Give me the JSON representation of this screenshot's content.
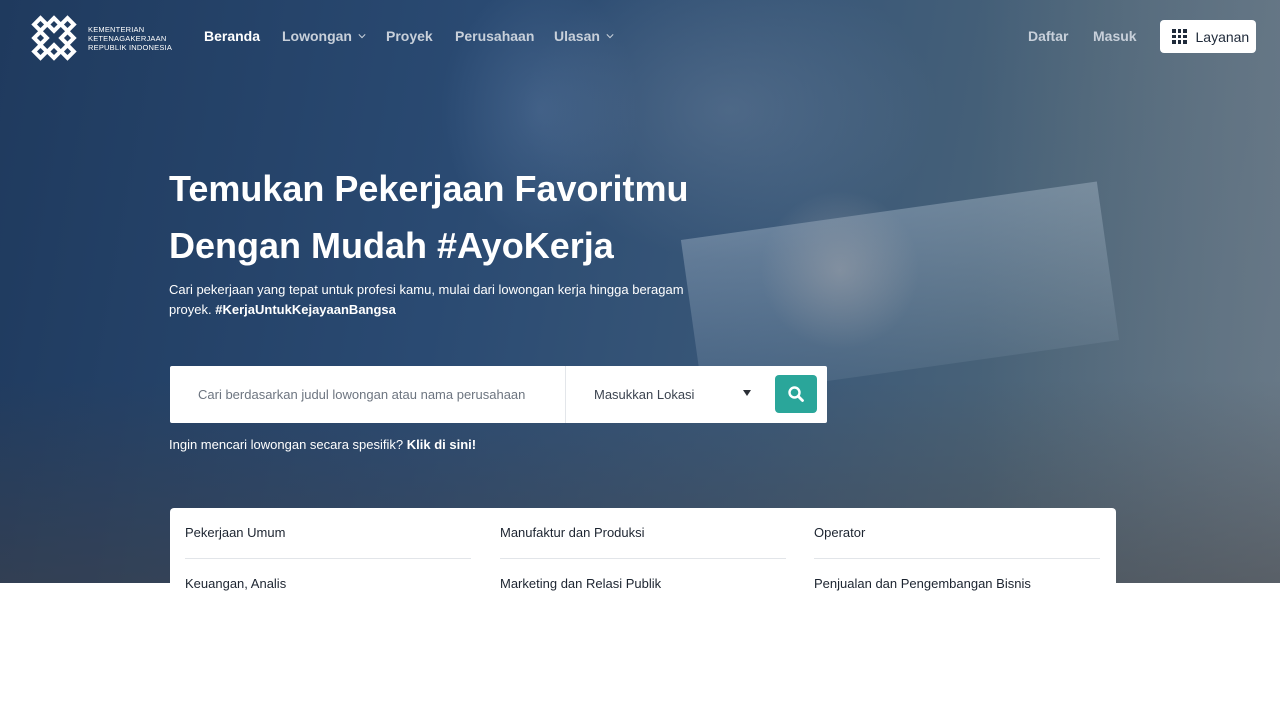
{
  "brand": {
    "line1": "KEMENTERIAN",
    "line2": "KETENAGAKERJAAN",
    "line3": "REPUBLIK INDONESIA"
  },
  "nav": {
    "items": [
      {
        "label": "Beranda"
      },
      {
        "label": "Lowongan"
      },
      {
        "label": "Proyek"
      },
      {
        "label": "Perusahaan"
      },
      {
        "label": "Ulasan"
      }
    ],
    "daftar": "Daftar",
    "masuk": "Masuk",
    "layanan": "Layanan"
  },
  "hero": {
    "title_line1": "Temukan Pekerjaan Favoritmu",
    "title_line2": "Dengan Mudah #AyoKerja",
    "subtitle": "Cari pekerjaan yang tepat untuk profesi kamu, mulai dari lowongan kerja hingga beragam proyek.",
    "hashtag": "#KerjaUntukKejayaanBangsa"
  },
  "search": {
    "placeholder": "Cari berdasarkan judul lowongan atau nama perusahaan",
    "location_placeholder": "Masukkan Lokasi",
    "specific_prefix": "Ingin mencari lowongan secara spesifik?",
    "specific_link": "Klik di sini!"
  },
  "categories": [
    "Pekerjaan Umum",
    "Manufaktur dan Produksi",
    "Operator",
    "Keuangan, Analis",
    "Marketing dan Relasi Publik",
    "Penjualan dan Pengembangan Bisnis"
  ],
  "colors": {
    "hero_bg": "#2a4a72",
    "accent": "#2aa69a",
    "white": "#ffffff"
  }
}
